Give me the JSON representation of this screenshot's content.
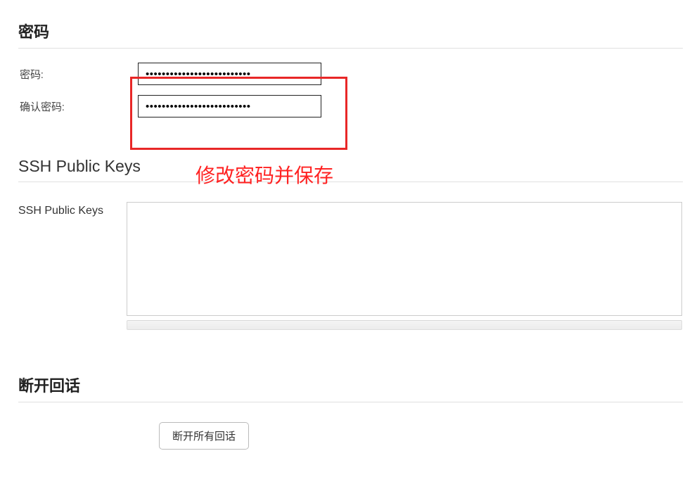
{
  "sections": {
    "password": {
      "heading": "密码",
      "labels": {
        "password": "密码:",
        "confirm": "确认密码:"
      },
      "values": {
        "password": "••••••••••••••••••••••••••",
        "confirm": "••••••••••••••••••••••••••"
      }
    },
    "ssh": {
      "heading": "SSH Public Keys",
      "label": "SSH Public Keys",
      "value": ""
    },
    "disconnect": {
      "heading": "断开回话",
      "button": "断开所有回话"
    }
  },
  "annotation_text": "修改密码并保存"
}
